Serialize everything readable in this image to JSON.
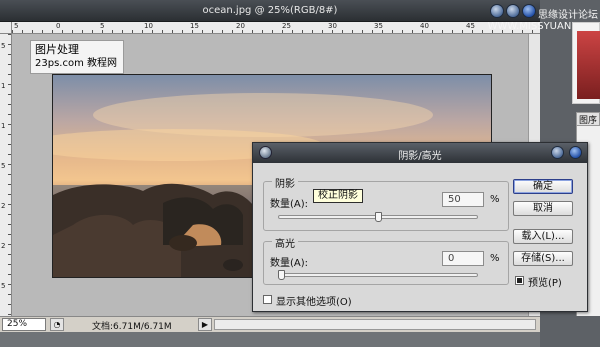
{
  "document": {
    "title": "ocean.jpg @ 25%(RGB/8#)",
    "ruler_top_labels": [
      "5",
      "0",
      "5",
      "10",
      "15",
      "20",
      "25",
      "30",
      "35",
      "40",
      "45"
    ],
    "ruler_left_labels": [
      "5",
      "1",
      "1",
      "5",
      "2",
      "2",
      "5"
    ],
    "zoom": "25%",
    "doc_size": "文档:6.71M/6.71M"
  },
  "watermark": {
    "line1": "图片处理",
    "line2": "23ps.com 教程网"
  },
  "site_banner": "思缘设计论坛  WWW.MISSYUAN.COM",
  "right_panel": {
    "tab_label": "图序"
  },
  "dialog": {
    "title": "阴影/高光",
    "shadows": {
      "legend": "阴影",
      "amount_label": "数量(A):",
      "amount_value": "50",
      "unit": "%",
      "slider_fraction": 0.5
    },
    "tooltip": "校正阴影",
    "highlights": {
      "legend": "高光",
      "amount_label": "数量(A):",
      "amount_value": "0",
      "unit": "%",
      "slider_fraction": 0
    },
    "more_options_label": "显示其他选项(O)",
    "more_options_checked": false,
    "buttons": {
      "ok": "确定",
      "cancel": "取消",
      "load": "载入(L)...",
      "save": "存储(S)..."
    },
    "preview_label": "预览(P)",
    "preview_checked": true
  }
}
